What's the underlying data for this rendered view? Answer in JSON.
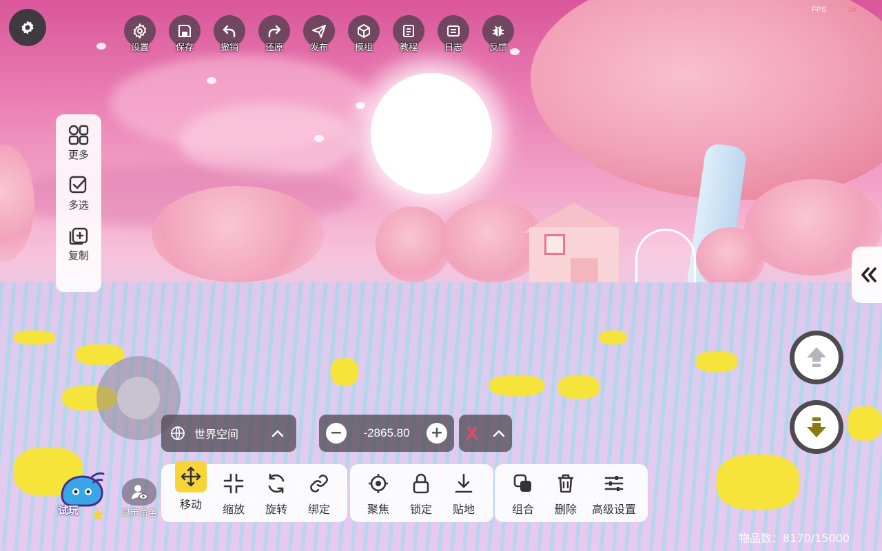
{
  "top_bar": {
    "settings": "设置",
    "save": "保存",
    "undo": "撤销",
    "redo": "还原",
    "publish": "发布",
    "module": "模组",
    "tutorial": "教程",
    "log": "日志",
    "feedback": "反馈"
  },
  "fps": {
    "label": "FPS",
    "value": "16"
  },
  "left_panel": {
    "more": "更多",
    "multi_select": "多选",
    "copy": "复制"
  },
  "transform": {
    "space_label": "世界空间",
    "value": "-2865.80",
    "axis": "X"
  },
  "toolbar": {
    "move": "移动",
    "scale": "缩放",
    "rotate": "旋转",
    "bind": "绑定",
    "focus": "聚焦",
    "lock": "锁定",
    "snap": "贴地",
    "group": "组合",
    "delete": "删除",
    "advanced": "高级设置"
  },
  "mascot_label": "试玩",
  "show_character": "显示角色",
  "item_count": "物品数：8170/15000",
  "colors": {
    "active_tool": "#f8d437",
    "axis_x": "#f1456a",
    "down_arrow": "#8a7a10"
  }
}
